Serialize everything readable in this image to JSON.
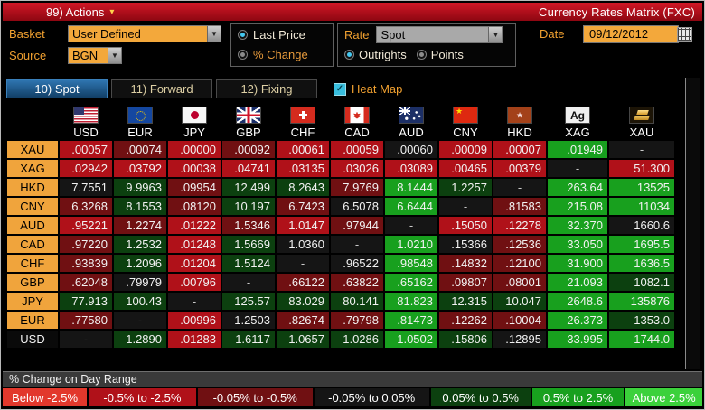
{
  "header": {
    "actions_label": "99) Actions",
    "title": "Currency Rates Matrix (FXC)"
  },
  "controls": {
    "basket_label": "Basket",
    "basket_value": "User Defined",
    "source_label": "Source",
    "source_value": "BGN",
    "price_mode": {
      "options": [
        "Last Price",
        "% Change"
      ],
      "selected": "Last Price"
    },
    "rate_label": "Rate",
    "rate_value": "Spot",
    "rate_mode": {
      "options": [
        "Outrights",
        "Points"
      ],
      "selected": "Outrights"
    },
    "date_label": "Date",
    "date_value": "09/12/2012"
  },
  "tabs": [
    {
      "label": "10) Spot",
      "active": true
    },
    {
      "label": "11) Forward",
      "active": false
    },
    {
      "label": "12) Fixing",
      "active": false
    }
  ],
  "heatmap": {
    "label": "Heat Map",
    "checked": true
  },
  "icons": {
    "actions_caret": "▾",
    "dropdown_arrow": "▼",
    "check": "✓",
    "star": "★"
  },
  "heat_colors": {
    "R1": "#e2382c",
    "R2": "#b01119",
    "R3": "#701012",
    "K": "#151515",
    "G3": "#0c400f",
    "G2": "#18a01e",
    "G1": "#3bd13b"
  },
  "matrix": {
    "columns": [
      {
        "code": "USD",
        "flag": "us"
      },
      {
        "code": "EUR",
        "flag": "eu"
      },
      {
        "code": "JPY",
        "flag": "jp"
      },
      {
        "code": "GBP",
        "flag": "gb"
      },
      {
        "code": "CHF",
        "flag": "ch"
      },
      {
        "code": "CAD",
        "flag": "ca"
      },
      {
        "code": "AUD",
        "flag": "au"
      },
      {
        "code": "CNY",
        "flag": "cn"
      },
      {
        "code": "HKD",
        "flag": "hk"
      },
      {
        "code": "XAG",
        "flag": "xag",
        "icon_text": "Ag"
      },
      {
        "code": "XAU",
        "flag": "xau"
      }
    ],
    "rows": [
      {
        "label": "XAU",
        "label_style": "orange",
        "values": [
          ".00057",
          ".00074",
          ".00000",
          ".00092",
          ".00061",
          ".00059",
          ".00060",
          ".00009",
          ".00007",
          ".01949",
          "-"
        ],
        "colors": [
          "R2",
          "R3",
          "R2",
          "R3",
          "R2",
          "R2",
          "K",
          "R2",
          "R2",
          "G2",
          "K"
        ]
      },
      {
        "label": "XAG",
        "label_style": "orange",
        "values": [
          ".02942",
          ".03792",
          ".00038",
          ".04741",
          ".03135",
          ".03026",
          ".03089",
          ".00465",
          ".00379",
          "-",
          "51.300"
        ],
        "colors": [
          "R2",
          "R2",
          "R2",
          "R2",
          "R2",
          "R2",
          "R2",
          "R2",
          "R2",
          "K",
          "R2"
        ]
      },
      {
        "label": "HKD",
        "label_style": "orange",
        "values": [
          "7.7551",
          "9.9963",
          ".09954",
          "12.499",
          "8.2643",
          "7.9769",
          "8.1444",
          "1.2257",
          "-",
          "263.64",
          "13525"
        ],
        "colors": [
          "K",
          "G3",
          "R3",
          "G3",
          "G3",
          "R3",
          "G2",
          "G3",
          "K",
          "G2",
          "G2"
        ]
      },
      {
        "label": "CNY",
        "label_style": "orange",
        "values": [
          "6.3268",
          "8.1553",
          ".08120",
          "10.197",
          "6.7423",
          "6.5078",
          "6.6444",
          "-",
          ".81583",
          "215.08",
          "11034"
        ],
        "colors": [
          "R3",
          "G3",
          "R3",
          "G3",
          "R3",
          "K",
          "G2",
          "K",
          "R3",
          "G2",
          "G2"
        ]
      },
      {
        "label": "AUD",
        "label_style": "orange",
        "values": [
          ".95221",
          "1.2274",
          ".01222",
          "1.5346",
          "1.0147",
          ".97944",
          "-",
          ".15050",
          ".12278",
          "32.370",
          "1660.6"
        ],
        "colors": [
          "R2",
          "R3",
          "R2",
          "R3",
          "R2",
          "R3",
          "K",
          "R2",
          "R2",
          "G2",
          "K"
        ]
      },
      {
        "label": "CAD",
        "label_style": "orange",
        "values": [
          ".97220",
          "1.2532",
          ".01248",
          "1.5669",
          "1.0360",
          "-",
          "1.0210",
          ".15366",
          ".12536",
          "33.050",
          "1695.5"
        ],
        "colors": [
          "R3",
          "G3",
          "R2",
          "G3",
          "K",
          "K",
          "G2",
          "K",
          "R3",
          "G2",
          "G2"
        ]
      },
      {
        "label": "CHF",
        "label_style": "orange",
        "values": [
          ".93839",
          "1.2096",
          ".01204",
          "1.5124",
          "-",
          ".96522",
          ".98548",
          ".14832",
          ".12100",
          "31.900",
          "1636.5"
        ],
        "colors": [
          "R3",
          "G3",
          "R2",
          "G3",
          "K",
          "K",
          "G2",
          "R3",
          "R3",
          "G2",
          "G2"
        ]
      },
      {
        "label": "GBP",
        "label_style": "orange",
        "values": [
          ".62048",
          ".79979",
          ".00796",
          "-",
          ".66122",
          ".63822",
          ".65162",
          ".09807",
          ".08001",
          "21.093",
          "1082.1"
        ],
        "colors": [
          "R3",
          "K",
          "R2",
          "K",
          "R3",
          "R3",
          "G2",
          "R3",
          "R3",
          "G2",
          "G3"
        ]
      },
      {
        "label": "JPY",
        "label_style": "orange",
        "values": [
          "77.913",
          "100.43",
          "-",
          "125.57",
          "83.029",
          "80.141",
          "81.823",
          "12.315",
          "10.047",
          "2648.6",
          "135876"
        ],
        "colors": [
          "G3",
          "G3",
          "K",
          "G3",
          "G3",
          "G3",
          "G2",
          "G3",
          "G3",
          "G2",
          "G2"
        ]
      },
      {
        "label": "EUR",
        "label_style": "orange",
        "values": [
          ".77580",
          "-",
          ".00996",
          "1.2503",
          ".82674",
          ".79798",
          ".81473",
          ".12262",
          ".10004",
          "26.373",
          "1353.0"
        ],
        "colors": [
          "R3",
          "K",
          "R2",
          "K",
          "R3",
          "R3",
          "G2",
          "R3",
          "R3",
          "G2",
          "G3"
        ]
      },
      {
        "label": "USD",
        "label_style": "dark",
        "values": [
          "-",
          "1.2890",
          ".01283",
          "1.6117",
          "1.0657",
          "1.0286",
          "1.0502",
          ".15806",
          ".12895",
          "33.995",
          "1744.0"
        ],
        "colors": [
          "K",
          "G3",
          "R2",
          "G3",
          "G3",
          "G3",
          "G2",
          "G3",
          "K",
          "G2",
          "G2"
        ]
      }
    ]
  },
  "legend": {
    "title": "% Change on Day Range",
    "buckets": [
      {
        "label": "Below -2.5%",
        "token": "R1"
      },
      {
        "label": "-0.5% to -2.5%",
        "token": "R2"
      },
      {
        "label": "-0.05% to -0.5%",
        "token": "R3"
      },
      {
        "label": "-0.05% to 0.05%",
        "token": "K"
      },
      {
        "label": "0.05% to 0.5%",
        "token": "G3"
      },
      {
        "label": "0.5% to 2.5%",
        "token": "G2"
      },
      {
        "label": "Above 2.5%",
        "token": "G1"
      }
    ]
  }
}
